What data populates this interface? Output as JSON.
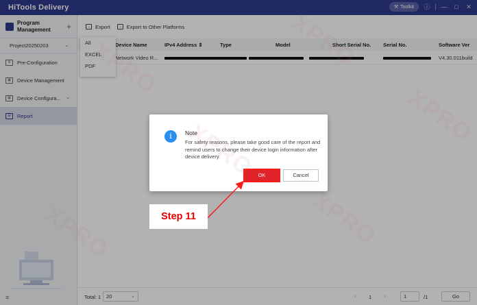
{
  "app": {
    "brand": "HiTools Delivery",
    "toolkit_label": "Toolkit",
    "accent_color": "#2f3a8c"
  },
  "sidebar": {
    "program_title": "Program Management",
    "project": "Project20250203",
    "items": [
      {
        "label": "Pre-Configuration",
        "icon": "gear-icon"
      },
      {
        "label": "Device Management",
        "icon": "device-icon"
      },
      {
        "label": "Device Configura...",
        "icon": "config-icon"
      },
      {
        "label": "Report",
        "icon": "report-icon",
        "active": true
      }
    ]
  },
  "toolbar": {
    "export": "Export",
    "export_other": "Export to Other Platforms"
  },
  "export_menu": [
    "All",
    "EXCEL",
    "PDF"
  ],
  "table": {
    "columns": [
      "Device Name",
      "IPv4 Address",
      "Type",
      "Model",
      "Short Serial No.",
      "Serial No.",
      "Software Ver"
    ],
    "rows": [
      {
        "device_name": "Network Video R...",
        "software_ver": "V4.30.011build"
      }
    ]
  },
  "footer": {
    "total": "Total: 1",
    "page_size": "20",
    "current_page": "1",
    "page_input": "1",
    "page_total": "/1",
    "go": "Go"
  },
  "dialog": {
    "title": "Note",
    "message": "For safety reasons, please take good care of the report and remind users to change their device login information after device delivery.",
    "ok": "OK",
    "cancel": "Cancel",
    "ok_color": "#e1232a"
  },
  "annotation": {
    "step_label": "Step 11",
    "color": "#ff1a1a"
  },
  "watermark_text": "XPRO"
}
